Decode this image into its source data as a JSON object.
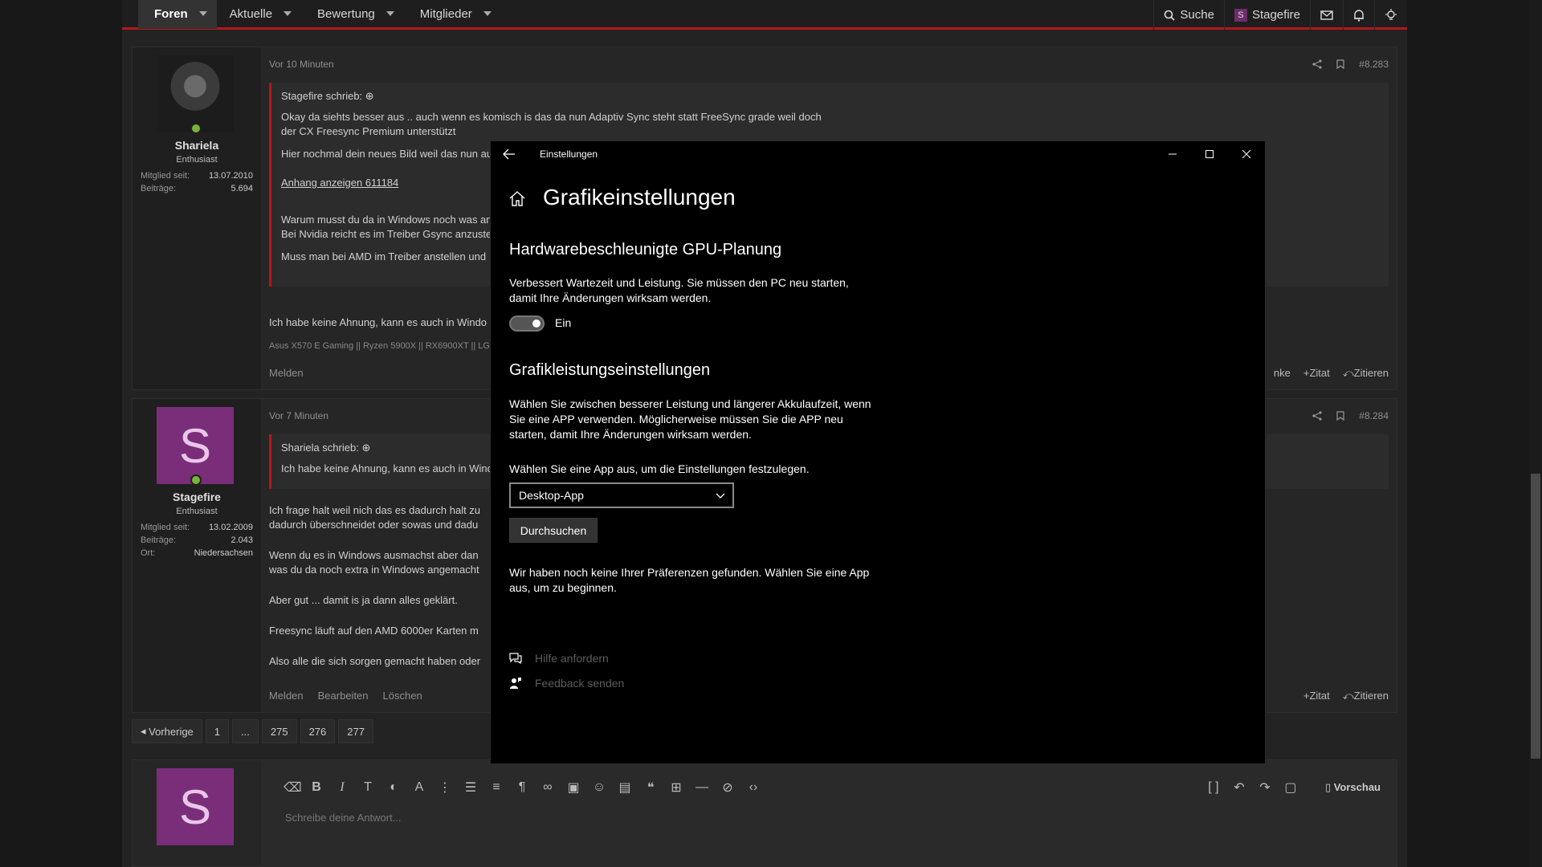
{
  "nav": {
    "items": [
      {
        "label": "Foren",
        "active": true
      },
      {
        "label": "Aktuelle"
      },
      {
        "label": "Bewertung"
      },
      {
        "label": "Mitglieder"
      }
    ],
    "search": "Suche",
    "user": "Stagefire",
    "user_initial": "S"
  },
  "posts": [
    {
      "user": "Shariela",
      "role": "Enthusiast",
      "member_since_label": "Mitglied seit:",
      "member_since": "13.07.2010",
      "posts_label": "Beiträge:",
      "posts": "5.694",
      "time": "Vor 10 Minuten",
      "number": "#8.283",
      "quote_author": "Stagefire schrieb:",
      "quote_lines": [
        "Okay da siehts besser aus .. auch wenn es komisch is das da nun Adaptiv Sync steht statt FreeSync grade weil doch",
        "der CX Freesync Premium unterstützt",
        "Hier nochmal dein neues Bild weil das nun au",
        "Anhang anzeigen 611184",
        "Warum musst du da in Windows noch was an",
        "Bei Nvidia reicht es im Treiber Gsync anzuste",
        "Muss man bei AMD im Treiber anstellen und"
      ],
      "text": "Ich habe keine Ahnung, kann es auch in Windo",
      "signature": "Asus X570 E Gaming || Ryzen 5900X || RX6900XT || LG",
      "action_report": "Melden",
      "action_thanks": "nke",
      "action_quote_plus": "+Zitat",
      "action_reply": "Zitieren"
    },
    {
      "user": "Stagefire",
      "initial": "S",
      "role": "Enthusiast",
      "member_since_label": "Mitglied seit:",
      "member_since": "13.02.2009",
      "posts_label": "Beiträge:",
      "posts": "2.043",
      "location_label": "Ort:",
      "location": "Niedersachsen",
      "time": "Vor 7 Minuten",
      "number": "#8.284",
      "quote_author": "Shariela schrieb:",
      "quote_text": "Ich habe keine Ahnung, kann es auch in Windo",
      "lines": [
        "Ich frage halt weil nich das es dadurch halt zu",
        "dadurch überschneidet oder sowas und dadu",
        "Wenn du es in Windows ausmachst aber dan",
        "was du da noch extra in Windows angemacht",
        "Aber gut ... damit is ja dann alles geklärt.",
        "Freesync läuft auf den AMD 6000er Karten m",
        "Also alle die sich sorgen gemacht haben oder"
      ],
      "action_report": "Melden",
      "action_edit": "Bearbeiten",
      "action_delete": "Löschen",
      "action_quote_plus": "+Zitat",
      "action_reply": "Zitieren"
    }
  ],
  "pager": [
    "Vorherige",
    "1",
    "...",
    "275",
    "276",
    "277"
  ],
  "reply": {
    "initial": "S",
    "placeholder": "Schreibe deine Antwort...",
    "preview": "Vorschau"
  },
  "settings": {
    "window_title": "Einstellungen",
    "page_title": "Grafikeinstellungen",
    "gpu_heading": "Hardwarebeschleunigte GPU-Planung",
    "gpu_desc_1": "Verbessert Wartezeit und Leistung. Sie müssen den PC neu starten,",
    "gpu_desc_2": "damit Ihre Änderungen wirksam werden.",
    "toggle_label": "Ein",
    "perf_heading": "Grafikleistungseinstellungen",
    "perf_desc_1": "Wählen Sie zwischen besserer Leistung und längerer Akkulaufzeit, wenn",
    "perf_desc_2": "Sie eine APP verwenden. Möglicherweise müssen Sie die APP neu",
    "perf_desc_3": "starten, damit Ihre Änderungen wirksam werden.",
    "choose_app": "Wählen Sie eine App aus, um die Einstellungen festzulegen.",
    "select_value": "Desktop-App",
    "browse": "Durchsuchen",
    "no_prefs_1": "Wir haben noch keine Ihrer Präferenzen gefunden. Wählen Sie eine App",
    "no_prefs_2": "aus, um zu beginnen.",
    "help": "Hilfe anfordern",
    "feedback": "Feedback senden"
  }
}
